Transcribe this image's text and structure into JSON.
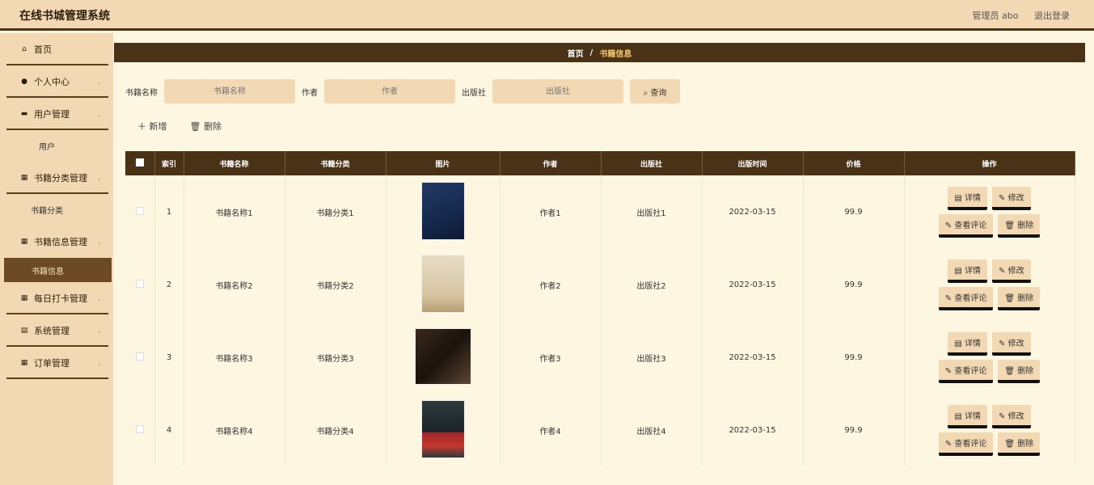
{
  "app": {
    "title": "在线书城管理系统",
    "admin": "管理员 abo",
    "logout": "退出登录"
  },
  "sidebar": {
    "home": "首页",
    "personal": "个人中心",
    "user_mgmt": "用户管理",
    "user": "用户",
    "category_mgmt": "书籍分类管理",
    "category": "书籍分类",
    "book_mgmt": "书籍信息管理",
    "book_info": "书籍信息",
    "checkin_mgmt": "每日打卡管理",
    "system_mgmt": "系统管理",
    "order_mgmt": "订单管理"
  },
  "breadcrumb": {
    "home": "首页",
    "sep": "/",
    "current": "书籍信息"
  },
  "search": {
    "name_label": "书籍名称",
    "name_placeholder": "书籍名称",
    "author_label": "作者",
    "author_placeholder": "作者",
    "publisher_label": "出版社",
    "publisher_placeholder": "出版社",
    "query_button": "查询"
  },
  "actions": {
    "add": "新增",
    "delete": "删除"
  },
  "table": {
    "headers": [
      "索引",
      "书籍名称",
      "书籍分类",
      "图片",
      "作者",
      "出版社",
      "出版时间",
      "价格",
      "操作"
    ],
    "ops": {
      "detail": "详情",
      "edit": "修改",
      "comments": "查看评论",
      "delete": "删除"
    },
    "rows": [
      {
        "index": "1",
        "name": "书籍名称1",
        "category": "书籍分类1",
        "author": "作者1",
        "publisher": "出版社1",
        "date": "2022-03-15",
        "price": "99.9"
      },
      {
        "index": "2",
        "name": "书籍名称2",
        "category": "书籍分类2",
        "author": "作者2",
        "publisher": "出版社2",
        "date": "2022-03-15",
        "price": "99.9"
      },
      {
        "index": "3",
        "name": "书籍名称3",
        "category": "书籍分类3",
        "author": "作者3",
        "publisher": "出版社3",
        "date": "2022-03-15",
        "price": "99.9"
      },
      {
        "index": "4",
        "name": "书籍名称4",
        "category": "书籍分类4",
        "author": "作者4",
        "publisher": "出版社4",
        "date": "2022-03-15",
        "price": "99.9"
      }
    ]
  },
  "colors": {
    "accent_dark": "#4a3217",
    "accent_light": "#f3d9b3",
    "background": "#fdf6e0"
  }
}
